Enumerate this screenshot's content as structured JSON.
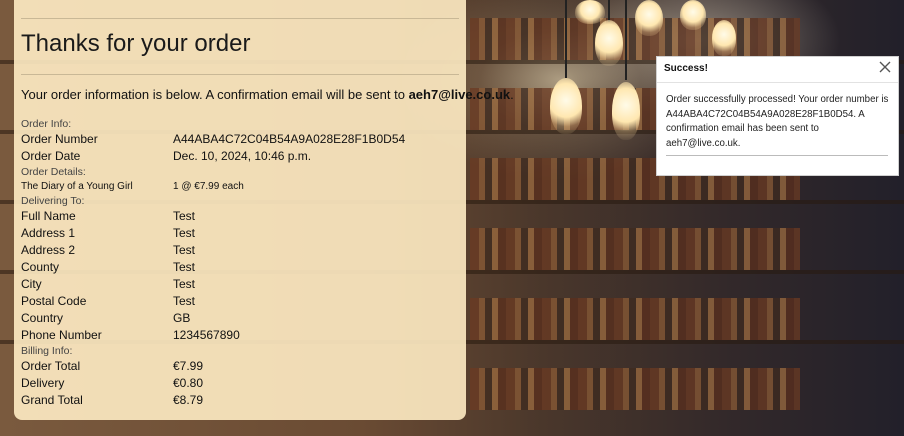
{
  "page": {
    "title": "Thanks for your order",
    "lead_prefix": "Your order information is below. A confirmation email will be sent to ",
    "lead_email": "aeh7@live.co.uk",
    "lead_suffix": "."
  },
  "order_info": {
    "label": "Order Info:",
    "order_number_key": "Order Number",
    "order_number": "A44ABA4C72C04B54A9A028E28F1B0D54",
    "order_date_key": "Order Date",
    "order_date": "Dec. 10, 2024, 10:46 p.m."
  },
  "order_details": {
    "label": "Order Details:",
    "items": [
      {
        "title": "The Diary of a Young Girl",
        "qty_price": "1 @ €7.99 each"
      }
    ]
  },
  "delivering_to": {
    "label": "Delivering To:",
    "rows": [
      {
        "key": "Full Name",
        "value": "Test"
      },
      {
        "key": "Address 1",
        "value": "Test"
      },
      {
        "key": "Address 2",
        "value": "Test"
      },
      {
        "key": "County",
        "value": "Test"
      },
      {
        "key": "City",
        "value": "Test"
      },
      {
        "key": "Postal Code",
        "value": "Test"
      },
      {
        "key": "Country",
        "value": "GB"
      },
      {
        "key": "Phone Number",
        "value": "1234567890"
      }
    ]
  },
  "billing_info": {
    "label": "Billing Info:",
    "rows": [
      {
        "key": "Order Total",
        "value": "€7.99"
      },
      {
        "key": "Delivery",
        "value": "€0.80"
      },
      {
        "key": "Grand Total",
        "value": "€8.79"
      }
    ]
  },
  "toast": {
    "title": "Success!",
    "message": "Order successfully processed! Your order number is A44ABA4C72C04B54A9A028E28F1B0D54. A confirmation email has been sent to aeh7@live.co.uk.",
    "close_icon": "close-icon"
  }
}
